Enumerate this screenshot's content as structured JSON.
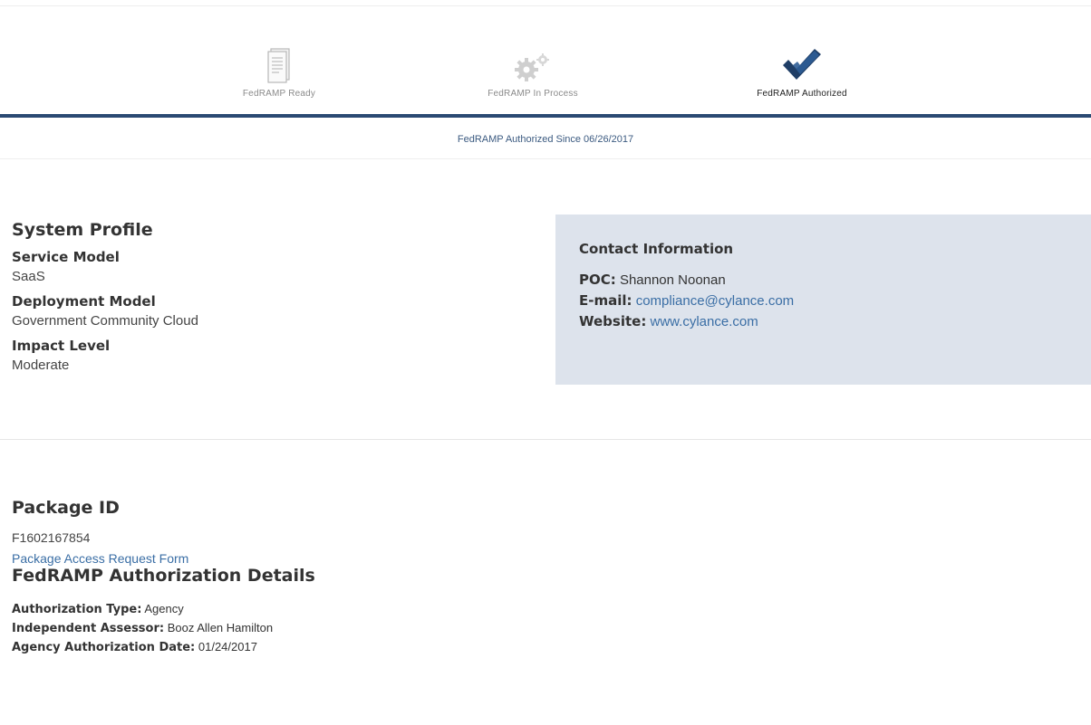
{
  "status_steps": [
    {
      "label": "FedRAMP Ready",
      "icon": "document-icon",
      "active": false
    },
    {
      "label": "FedRAMP In Process",
      "icon": "gears-icon",
      "active": false
    },
    {
      "label": "FedRAMP Authorized",
      "icon": "checkmark-icon",
      "active": true
    }
  ],
  "status_line": "FedRAMP Authorized Since 06/26/2017",
  "system_profile": {
    "title": "System Profile",
    "service_model_label": "Service Model",
    "service_model": "SaaS",
    "deployment_model_label": "Deployment Model",
    "deployment_model": "Government Community Cloud",
    "impact_level_label": "Impact Level",
    "impact_level": "Moderate"
  },
  "contact": {
    "title": "Contact Information",
    "poc_label": "POC:",
    "poc": "Shannon Noonan",
    "email_label": "E-mail:",
    "email": "compliance@cylance.com",
    "website_label": "Website:",
    "website": "www.cylance.com"
  },
  "package": {
    "title": "Package ID",
    "id": "F1602167854",
    "request_form_link": "Package Access Request Form"
  },
  "authorization": {
    "title": "FedRAMP Authorization Details",
    "type_label": "Authorization Type:",
    "type": "Agency",
    "assessor_label": "Independent Assessor:",
    "assessor": "Booz Allen Hamilton",
    "date_label": "Agency Authorization Date:",
    "date": "01/24/2017"
  },
  "colors": {
    "accent_bar": "#2b4a73",
    "link": "#3a6ea5",
    "contact_bg": "#dde3ec",
    "checkmark": "#2b4a73"
  }
}
